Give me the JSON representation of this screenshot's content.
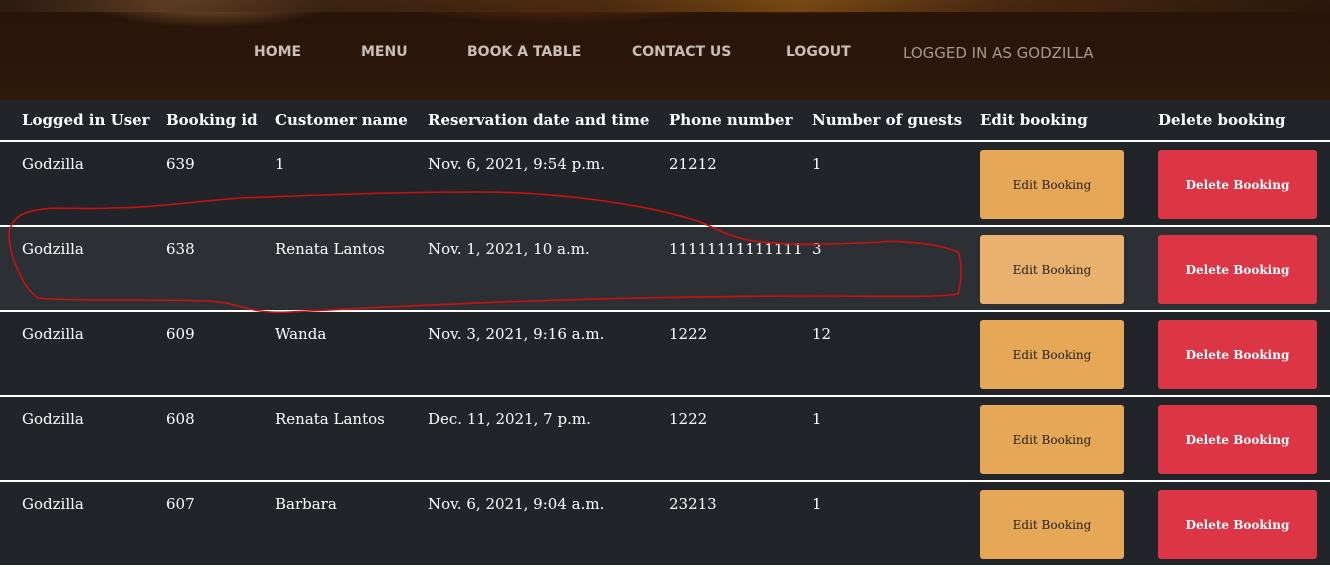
{
  "nav": {
    "items": [
      "HOME",
      "MENU",
      "BOOK A TABLE",
      "CONTACT US",
      "LOGOUT"
    ],
    "logged_in_text": "LOGGED IN AS GODZILLA"
  },
  "table": {
    "headers": [
      "Logged in User",
      "Booking id",
      "Customer name",
      "Reservation date and time",
      "Phone number",
      "Number of guests",
      "Edit booking",
      "Delete booking"
    ],
    "rows": [
      {
        "user": "Godzilla",
        "booking_id": "639",
        "customer": "1",
        "datetime": "Nov. 6, 2021, 9:54 p.m.",
        "phone": "21212",
        "guests": "1",
        "edit_label": "Edit Booking",
        "delete_label": "Delete Booking"
      },
      {
        "user": "Godzilla",
        "booking_id": "638",
        "customer": "Renata Lantos",
        "datetime": "Nov. 1, 2021, 10 a.m.",
        "phone": "11111111111111",
        "guests": "3",
        "edit_label": "Edit Booking",
        "delete_label": "Delete Booking"
      },
      {
        "user": "Godzilla",
        "booking_id": "609",
        "customer": "Wanda",
        "datetime": "Nov. 3, 2021, 9:16 a.m.",
        "phone": "1222",
        "guests": "12",
        "edit_label": "Edit Booking",
        "delete_label": "Delete Booking"
      },
      {
        "user": "Godzilla",
        "booking_id": "608",
        "customer": "Renata Lantos",
        "datetime": "Dec. 11, 2021, 7 p.m.",
        "phone": "1222",
        "guests": "1",
        "edit_label": "Edit Booking",
        "delete_label": "Delete Booking"
      },
      {
        "user": "Godzilla",
        "booking_id": "607",
        "customer": "Barbara",
        "datetime": "Nov. 6, 2021, 9:04 a.m.",
        "phone": "23213",
        "guests": "1",
        "edit_label": "Edit Booking",
        "delete_label": "Delete Booking"
      }
    ]
  },
  "colors": {
    "edit_button": "#e6a756",
    "delete_button": "#dc3545",
    "table_background": "#212529",
    "annotation_stroke": "#cc1111"
  }
}
